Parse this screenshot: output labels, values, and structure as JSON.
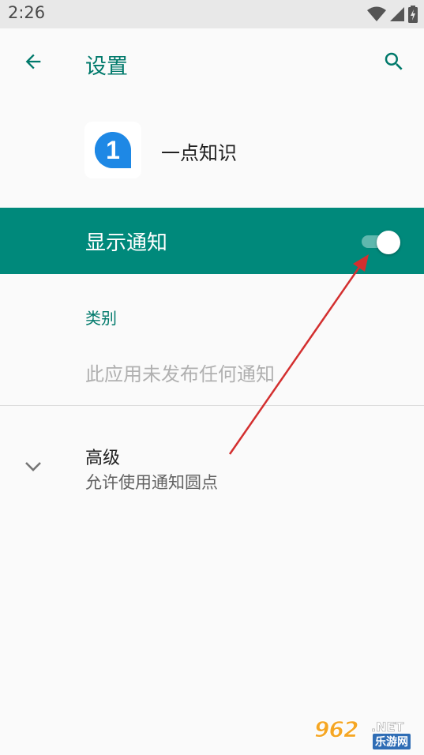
{
  "status_bar": {
    "time": "2:26",
    "icons": [
      "wifi-icon",
      "signal-icon",
      "battery-icon"
    ]
  },
  "app_bar": {
    "title": "设置",
    "back_icon": "arrow-back-icon",
    "search_icon": "search-icon"
  },
  "app_header": {
    "app_name": "一点知识",
    "app_icon_glyph": "1",
    "app_icon_color": "#1e88e5"
  },
  "master_switch": {
    "label": "显示通知",
    "state": "on"
  },
  "category": {
    "label": "类别",
    "empty_text": "此应用未发布任何通知"
  },
  "advanced": {
    "title": "高级",
    "summary": "允许使用通知圆点",
    "icon": "chevron-down-icon"
  },
  "watermark": {
    "brand": "962",
    "suffix": ".NET",
    "sub": "乐游网"
  },
  "colors": {
    "accent": "#00796b",
    "switch_bar": "#00897b",
    "annotation_arrow": "#d32f2f"
  }
}
